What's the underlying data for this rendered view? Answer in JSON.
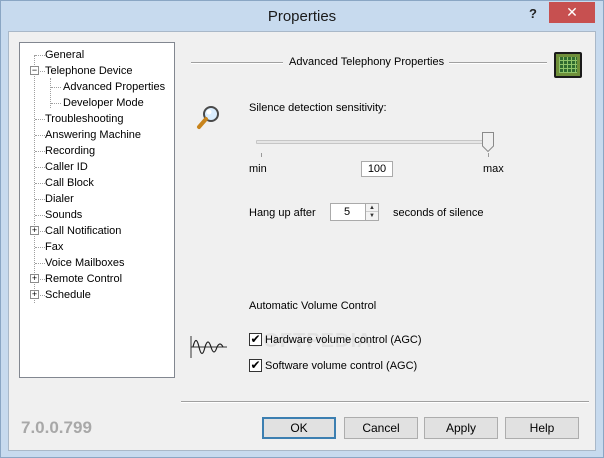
{
  "window": {
    "title": "Properties",
    "help_glyph": "?",
    "close_glyph": "✕"
  },
  "tree": {
    "items": [
      {
        "label": "General"
      },
      {
        "label": "Telephone Device"
      },
      {
        "label": "Advanced Properties"
      },
      {
        "label": "Developer Mode"
      },
      {
        "label": "Troubleshooting"
      },
      {
        "label": "Answering Machine"
      },
      {
        "label": "Recording"
      },
      {
        "label": "Caller ID"
      },
      {
        "label": "Call Block"
      },
      {
        "label": "Dialer"
      },
      {
        "label": "Sounds"
      },
      {
        "label": "Call Notification"
      },
      {
        "label": "Fax"
      },
      {
        "label": "Voice Mailboxes"
      },
      {
        "label": "Remote Control"
      },
      {
        "label": "Schedule"
      }
    ],
    "expander_collapsed": "+",
    "expander_expanded": "−"
  },
  "version": "7.0.0.799",
  "panel": {
    "header": "Advanced Telephony Properties",
    "silence_label": "Silence detection sensitivity:",
    "slider": {
      "min_label": "min",
      "max_label": "max",
      "value": "100"
    },
    "hangup_prefix": "Hang up after",
    "hangup_value": "5",
    "hangup_suffix": "seconds of silence",
    "agc_title": "Automatic Volume Control",
    "hardware_agc": {
      "label": "Hardware volume control (AGC)",
      "checked": true
    },
    "software_agc": {
      "label": "Software volume control (AGC)",
      "checked": true
    },
    "check_glyph": "✔",
    "spin_up": "▲",
    "spin_down": "▼",
    "watermark": "SOFTPEDIA"
  },
  "buttons": {
    "ok": "OK",
    "cancel": "Cancel",
    "apply": "Apply",
    "help": "Help"
  }
}
